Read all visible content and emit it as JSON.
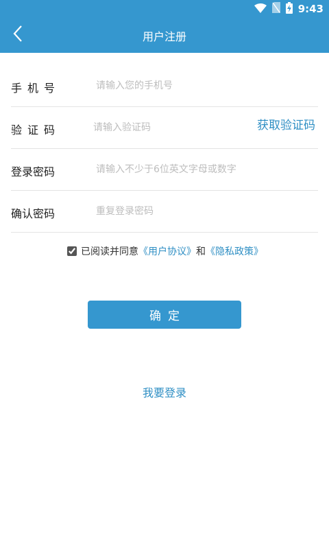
{
  "status_bar": {
    "time": "9:43",
    "icons": [
      "wifi-icon",
      "no-sim-icon",
      "battery-charging-icon"
    ]
  },
  "header": {
    "title": "用户注册",
    "back_icon": "chevron-left-icon"
  },
  "form": {
    "phone": {
      "label": "手机号",
      "placeholder": "请输入您的手机号"
    },
    "code": {
      "label": "验证码",
      "placeholder": "请输入验证码",
      "get_code_label": "获取验证码"
    },
    "password": {
      "label": "登录密码",
      "placeholder": "请输入不少于6位英文字母或数字"
    },
    "confirm_password": {
      "label": "确认密码",
      "placeholder": "重复登录密码"
    }
  },
  "agreement": {
    "prefix": "已阅读并同意",
    "user_agreement": "《用户协议》",
    "conjunction": "和",
    "privacy_policy": "《隐私政策》",
    "checked": true
  },
  "confirm_label": "确定",
  "login_label": "我要登录",
  "colors": {
    "primary": "#3597cf",
    "link": "#2f8fc4"
  }
}
